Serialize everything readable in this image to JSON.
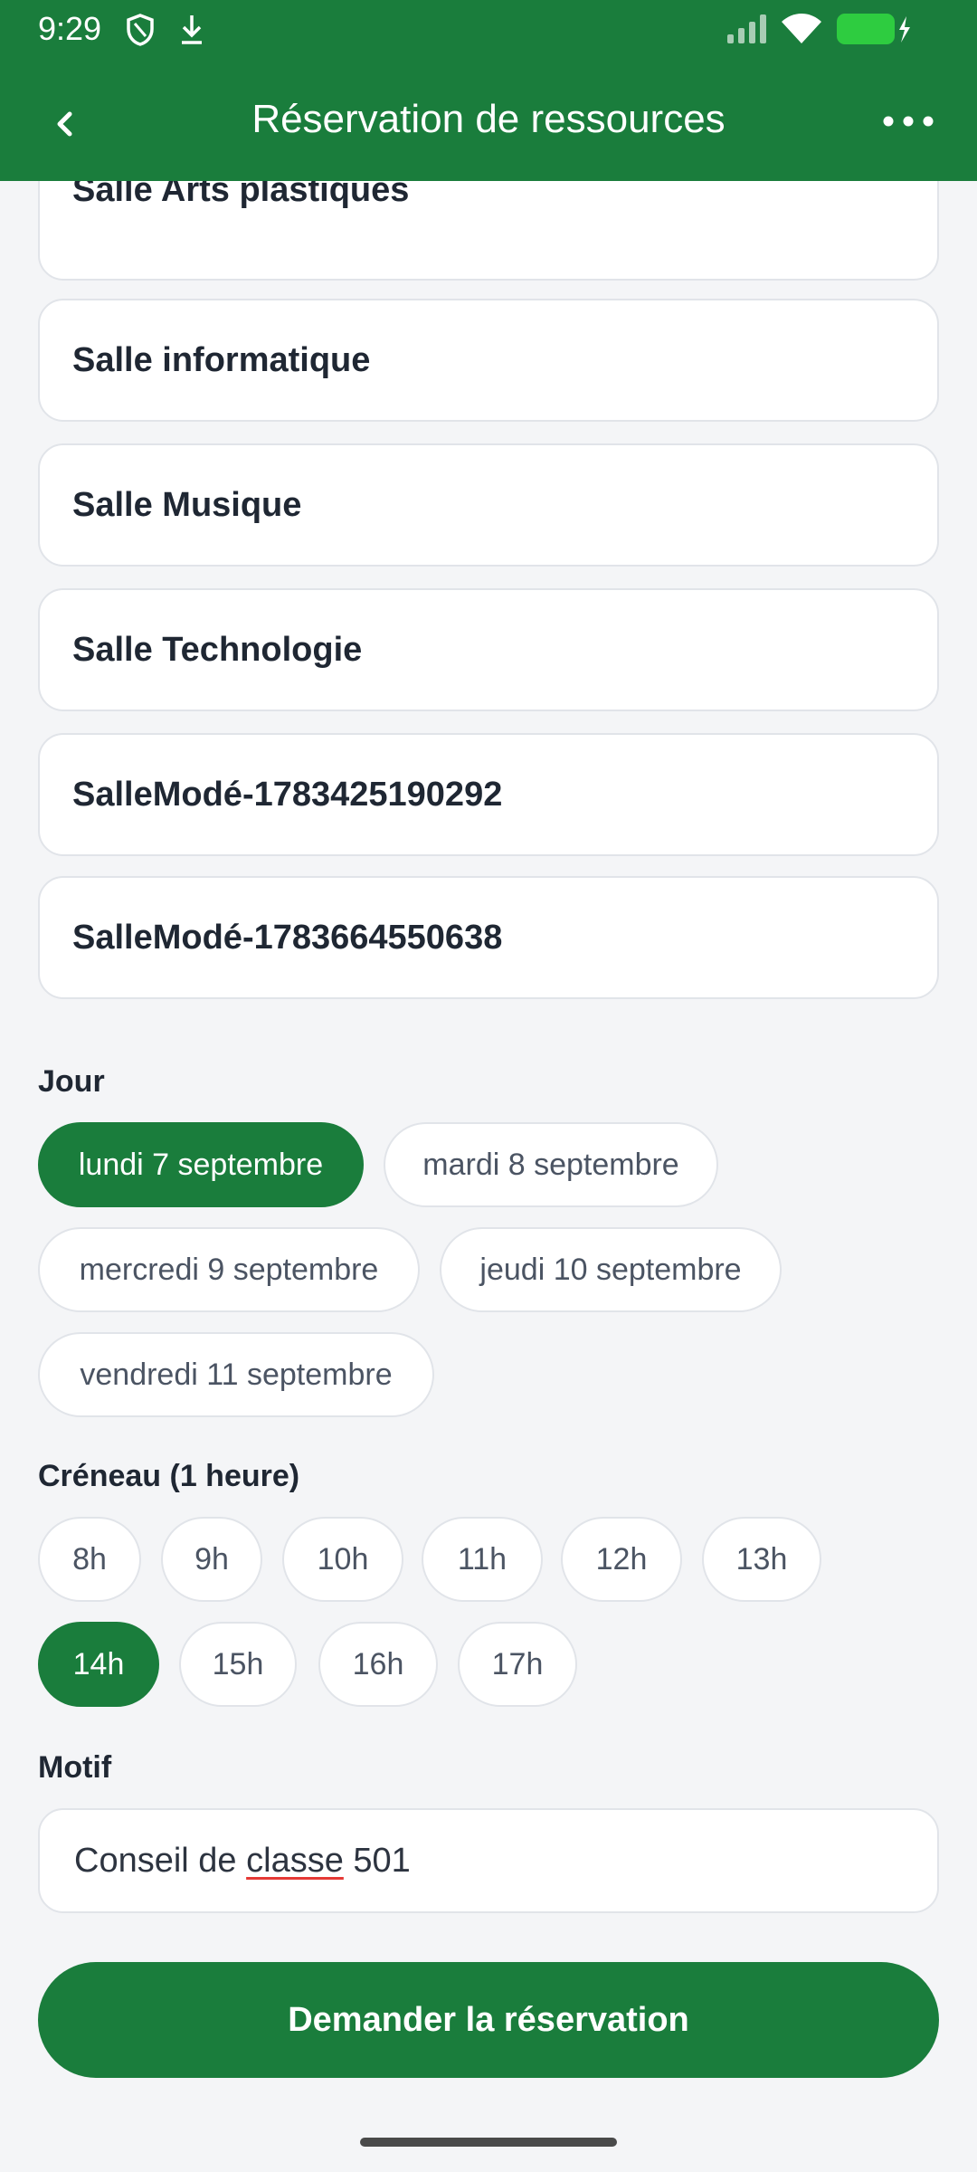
{
  "status_bar": {
    "time": "9:29",
    "icons": [
      "shield-icon",
      "download-icon",
      "signal-icon",
      "wifi-icon",
      "battery-charging-icon"
    ],
    "battery_color": "#2ecc40"
  },
  "header": {
    "title": "Réservation de ressources",
    "back_icon": "chevron-left-icon",
    "more_icon": "more-horizontal-icon",
    "color": "#1a7d3c"
  },
  "resources": [
    "Salle Arts plastiques",
    "Salle informatique",
    "Salle Musique",
    "Salle Technologie",
    "SalleModé-1783425190292",
    "SalleModé-1783664550638"
  ],
  "day_section": {
    "label": "Jour",
    "options": [
      "lundi 7 septembre",
      "mardi 8 septembre",
      "mercredi 9 septembre",
      "jeudi 10 septembre",
      "vendredi 11 septembre"
    ],
    "selected": "lundi 7 septembre"
  },
  "slot_section": {
    "label": "Créneau (1 heure)",
    "options": [
      "8h",
      "9h",
      "10h",
      "11h",
      "12h",
      "13h",
      "14h",
      "15h",
      "16h",
      "17h"
    ],
    "selected": "14h"
  },
  "motif": {
    "label": "Motif",
    "value_before": "Conseil de ",
    "value_misspelled": "classe",
    "value_after": " 501"
  },
  "submit_label": "Demander la réservation"
}
